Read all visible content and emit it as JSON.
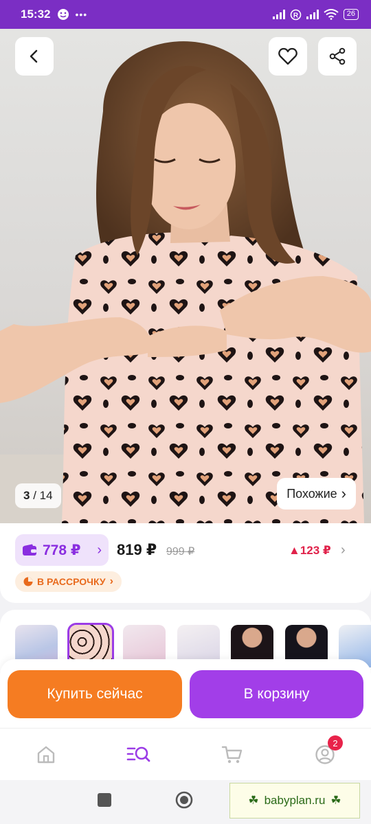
{
  "status_bar": {
    "time": "15:32",
    "battery": "26"
  },
  "gallery": {
    "current": "3",
    "total": "14",
    "similar_label": "Похожие",
    "similar_chevron": "›"
  },
  "price": {
    "wallet_price": "778 ₽",
    "main_price": "819 ₽",
    "old_price": "999 ₽",
    "delta": "▲123 ₽",
    "installment": "В РАССРОЧКУ",
    "installment_chevron": "›",
    "wallet_chevron": "›",
    "details_chevron": "›"
  },
  "actions": {
    "buy_now": "Купить сейчас",
    "add_to_cart": "В корзину"
  },
  "nav": {
    "profile_badge": "2"
  },
  "watermark": {
    "text": "babyplan.ru"
  },
  "colors": {
    "accent": "#a23ee8",
    "buy": "#f57c22",
    "status": "#7b2ec4",
    "price_up": "#e0224a"
  },
  "icons": {
    "back": "chevron-left-icon",
    "favorite": "heart-icon",
    "share": "share-icon",
    "home": "home-icon",
    "catalog": "search-catalog-icon",
    "cart": "cart-icon",
    "profile": "profile-icon"
  }
}
